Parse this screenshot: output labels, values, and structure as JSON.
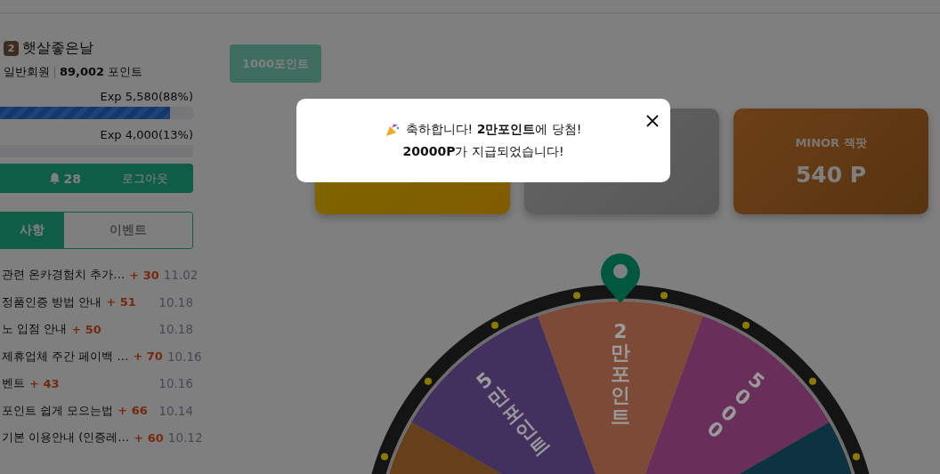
{
  "user": {
    "level": "2",
    "nickname": "햇살좋은날",
    "grade": "일반회원",
    "points": "**89,002** 포인트"
  },
  "exp_bars": [
    {
      "label": "Exp 5,580(88%)",
      "level": 0.88
    },
    {
      "label": "Exp 4,000(13%)"
    }
  ],
  "action_bar": {
    "notifications": "28",
    "logout": "로그아웃"
  },
  "tabs": [
    {
      "label": "사항",
      "selected": true
    },
    {
      "label": "이벤트",
      "selected": false
    }
  ],
  "posts": [
    {
      "title": "관련 온카경험치 추가…",
      "points": "+ 30",
      "date": "11.02"
    },
    {
      "title": "정품인증 방법 안내",
      "points": "+ 51",
      "date": "10.18"
    },
    {
      "title": "노 입점 안내",
      "points": "+ 50",
      "date": "10.18"
    },
    {
      "title": "제휴업체 주간 페이백 …",
      "points": "+ 70",
      "date": "10.16"
    },
    {
      "title": "벤트",
      "points": "+ 43",
      "date": "10.16"
    },
    {
      "title": "포인트 쉽게 모으는법",
      "points": "+ 66",
      "date": "10.14"
    },
    {
      "title": "기본 이용안내 (인증레…",
      "points": "+ 60",
      "date": "10.12"
    }
  ],
  "point_button": "1000포인트",
  "cards": [
    {
      "kind": "gold"
    },
    {
      "kind": "silver"
    },
    {
      "kind": "bronze",
      "title": "MINOR 잭팟",
      "value": "540 P"
    }
  ],
  "wheel": {
    "segments": [
      {
        "color": "#66401a"
      },
      {
        "color": "#42305f",
        "label": "5만포인트"
      },
      {
        "color": "#7e4a38",
        "label": "2만포인트"
      },
      {
        "color": "#6a2e5a",
        "label": "5000"
      },
      {
        "color": "#0d3340"
      }
    ]
  },
  "modal": {
    "lines": [
      "축하합니다! **2만포인트**에 당첨!",
      "**20000P**가 지급되었습니다!"
    ]
  }
}
